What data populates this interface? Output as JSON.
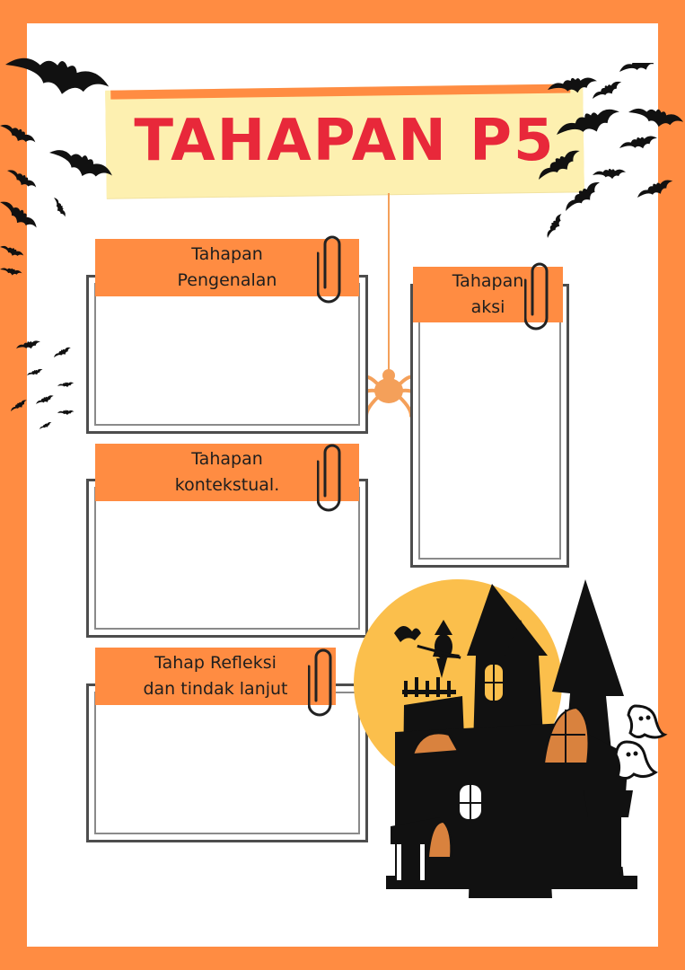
{
  "title": "TAHAPAN P5",
  "stages": [
    {
      "label": "Tahapan\nPengenalan"
    },
    {
      "label": "Tahapan\nkontekstual."
    },
    {
      "label": "Tahap Refleksi\ndan tindak lanjut"
    },
    {
      "label": "Tahapan\naksi"
    }
  ],
  "colors": {
    "border": "#ff8c42",
    "title": "#e8283a",
    "banner": "#fdf0b0",
    "moon": "#fbbf4c",
    "silhouette": "#111111"
  },
  "icons": [
    "bat-icon",
    "paperclip-icon",
    "spider-icon",
    "haunted-house-icon",
    "witch-icon",
    "ghost-icon",
    "moon-icon"
  ]
}
